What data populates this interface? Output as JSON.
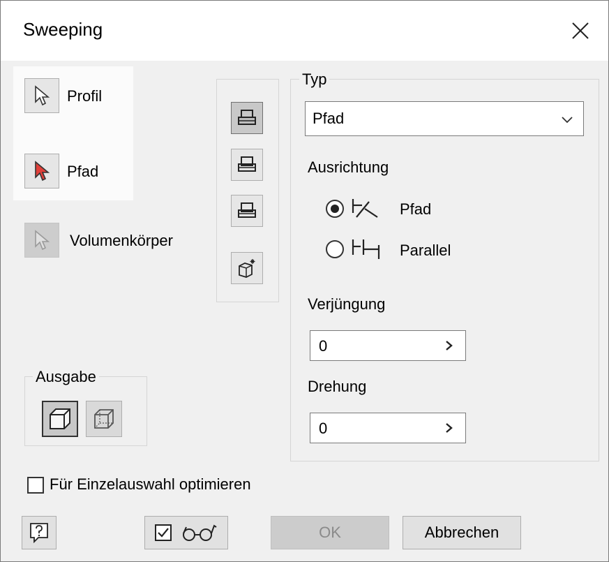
{
  "window": {
    "title": "Sweeping"
  },
  "selection": {
    "profile_label": "Profil",
    "path_label": "Pfad",
    "solid_label": "Volumenkörper"
  },
  "type_group": {
    "legend": "Typ",
    "selected": "Pfad",
    "orientation_label": "Ausrichtung",
    "orientation_options": [
      {
        "label": "Pfad",
        "selected": true
      },
      {
        "label": "Parallel",
        "selected": false
      }
    ],
    "taper_label": "Verjüngung",
    "taper_value": "0",
    "twist_label": "Drehung",
    "twist_value": "0"
  },
  "output": {
    "legend": "Ausgabe"
  },
  "optimize_checkbox": {
    "label": "Für Einzelauswahl optimieren",
    "checked": false
  },
  "buttons": {
    "ok": "OK",
    "cancel": "Abbrechen"
  },
  "icons": {
    "close": "close-icon",
    "cursor": "cursor-arrow-icon",
    "help": "help-icon",
    "preview": "glasses-icon"
  },
  "colors": {
    "path_cursor_accent": "#e0403a",
    "selection_panel_bg": "#fbfbfb"
  }
}
